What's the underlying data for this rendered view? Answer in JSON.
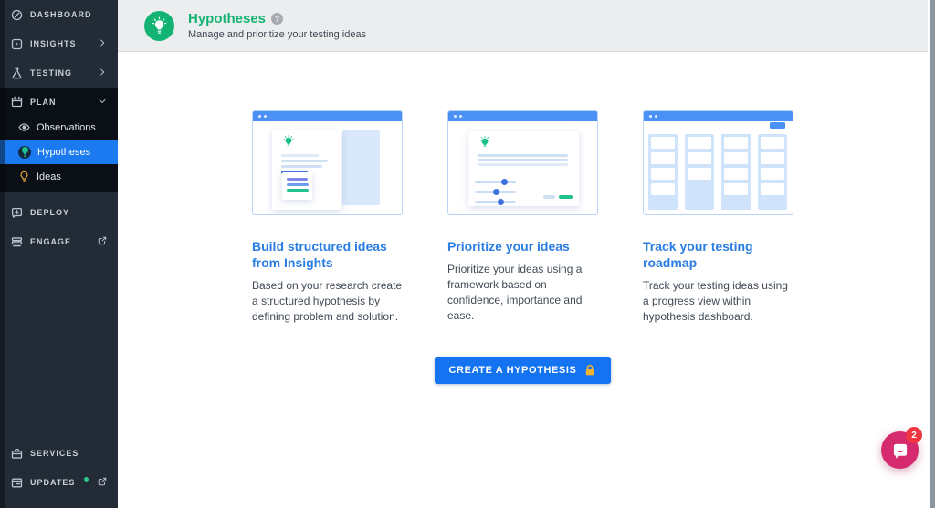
{
  "sidebar": {
    "items": [
      {
        "label": "DASHBOARD",
        "icon": "dashboard-icon"
      },
      {
        "label": "INSIGHTS",
        "icon": "insights-icon",
        "chevron": "right"
      },
      {
        "label": "TESTING",
        "icon": "testing-icon",
        "chevron": "right"
      },
      {
        "label": "PLAN",
        "icon": "plan-icon",
        "chevron": "down",
        "expanded": true
      },
      {
        "label": "Observations",
        "icon": "eye-icon"
      },
      {
        "label": "Hypotheses",
        "icon": "lightbulb-icon",
        "active": true
      },
      {
        "label": "Ideas",
        "icon": "lightbulb-outline-icon"
      },
      {
        "label": "DEPLOY",
        "icon": "deploy-icon"
      },
      {
        "label": "ENGAGE",
        "icon": "engage-icon",
        "external_link": true
      },
      {
        "label": "SERVICES",
        "icon": "services-icon"
      },
      {
        "label": "UPDATES",
        "icon": "updates-icon",
        "external_link": true,
        "notification_dot": true
      }
    ]
  },
  "header": {
    "title": "Hypotheses",
    "subtitle": "Manage and prioritize your testing ideas",
    "help_icon": "?",
    "icon": "lightbulb-icon"
  },
  "cards": [
    {
      "title": "Build structured ideas from Insights",
      "body": "Based on your research create a structured hypothesis by defining problem and solution."
    },
    {
      "title": "Prioritize your ideas",
      "body": "Prioritize your ideas using a framework based on confidence, importance and ease."
    },
    {
      "title": "Track your testing roadmap",
      "body": "Track your testing ideas using a progress view within hypothesis dashboard."
    }
  ],
  "cta": {
    "label": "CREATE A HYPOTHESIS",
    "icon": "lock-icon"
  },
  "chat": {
    "badge_count": "2",
    "icon": "chat-bubble-icon"
  },
  "colors": {
    "sidebar_bg": "#232b37",
    "sidebar_section_bg": "#0b1017",
    "active_item_blue": "#1b7af0",
    "brand_green": "#13b374",
    "link_blue": "#2a7de2",
    "button_blue": "#1373f0",
    "illustration_blue": "#4a90f5",
    "chat_pink": "#d62a6e",
    "badge_red": "#ee3540",
    "lock_gold": "#f0b233"
  }
}
